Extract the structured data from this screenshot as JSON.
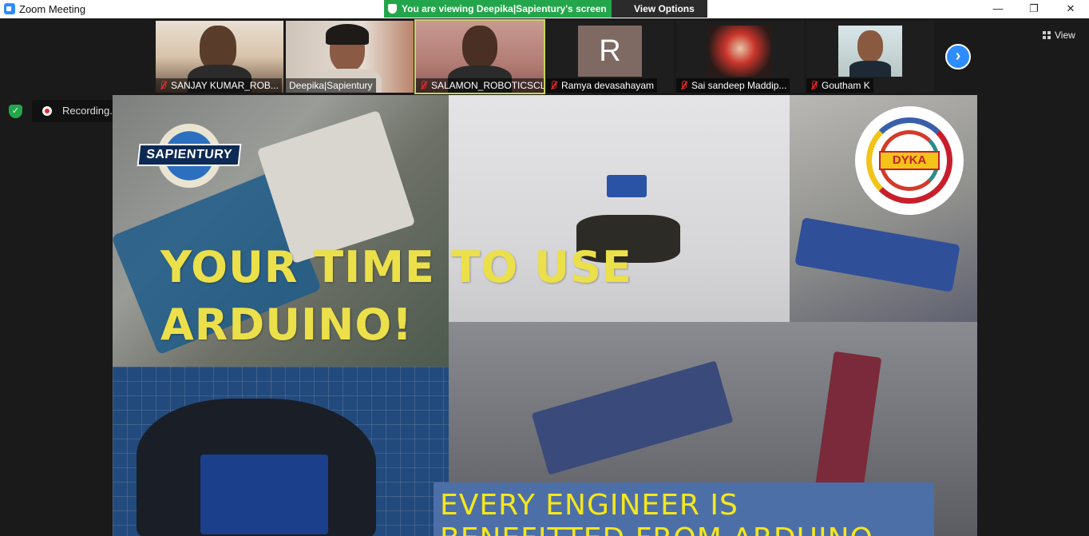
{
  "window": {
    "title": "Zoom Meeting",
    "minimize_glyph": "—",
    "maximize_glyph": "❐",
    "close_glyph": "✕"
  },
  "share_banner": {
    "text": "You are viewing Deepika|Sapientury's screen",
    "view_options_label": "View Options",
    "chevron": "⌄",
    "color": "#23a64b"
  },
  "participants": [
    {
      "name": "SANJAY KUMAR_ROB...",
      "muted": true,
      "avatar": null
    },
    {
      "name": "Deepika|Sapientury",
      "muted": false,
      "avatar": null
    },
    {
      "name": "SALAMON_ROBOTICSCL...",
      "muted": true,
      "avatar": null,
      "active_speaker": true
    },
    {
      "name": "Ramya devasahayam",
      "muted": true,
      "avatar": "R"
    },
    {
      "name": "Sai sandeep Maddip...",
      "muted": true,
      "avatar": null
    },
    {
      "name": "Goutham K",
      "muted": true,
      "avatar": null
    }
  ],
  "controls": {
    "next_page_glyph": "›",
    "view_label": "View",
    "recording_label": "Recording...",
    "pause_glyph": "❚❚",
    "stop_glyph": "■",
    "security_glyph": "✓"
  },
  "slide": {
    "logo_left": "SAPIENTURY",
    "logo_right": "DYKA",
    "headline_line1": "YOUR TIME TO USE",
    "headline_line2": "ARDUINO!",
    "caption_line1": "EVERY ENGINEER IS",
    "caption_line2": "BENEFITTED FROM ARDUINO",
    "headline_color": "#ece04a",
    "caption_color": "#f6e71a"
  },
  "icons": {
    "app": "zoom-app-icon",
    "mute": "mic-muted-icon",
    "next": "chevron-right-icon",
    "view": "grid-icon",
    "security": "shield-check-icon",
    "record": "record-icon"
  }
}
